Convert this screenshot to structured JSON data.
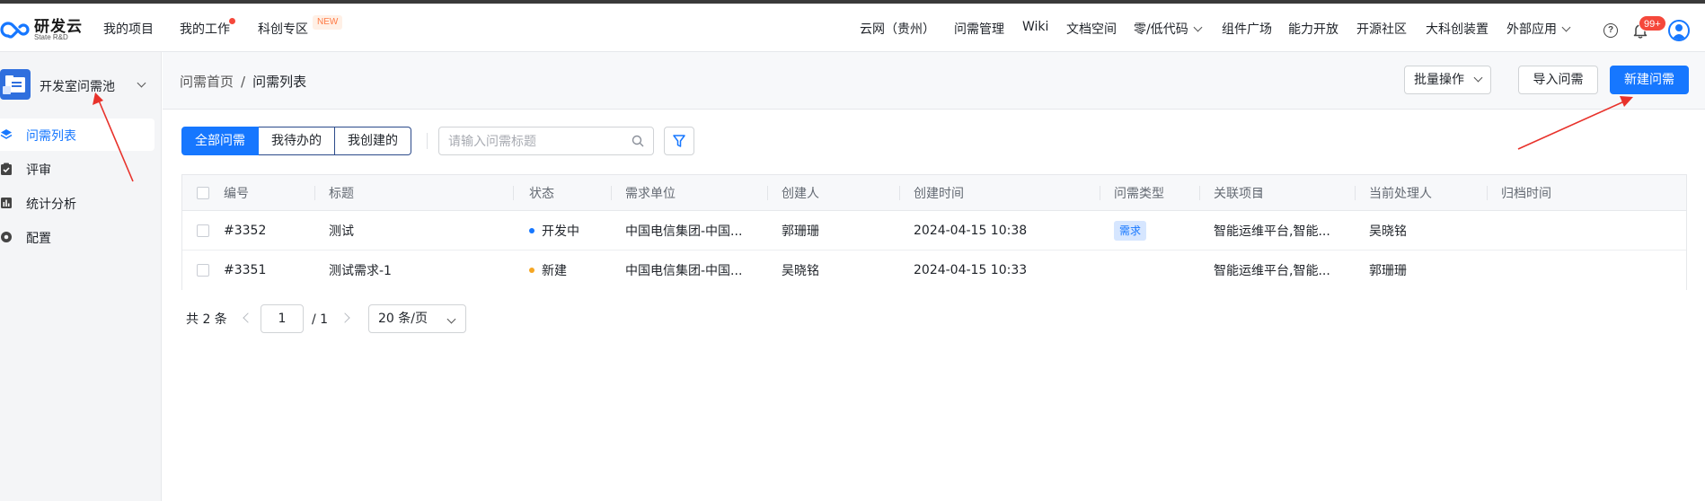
{
  "app": {
    "logo_title": "研发云",
    "logo_subtitle": "State R&D"
  },
  "topnav": {
    "left_items": [
      "我的项目",
      "我的工作",
      "科创专区"
    ],
    "new_tag": "NEW",
    "right_items": [
      "云网（贵州）",
      "问需管理",
      "Wiki",
      "文档空间",
      "零/低代码",
      "组件广场",
      "能力开放",
      "开源社区",
      "大科创装置",
      "外部应用"
    ],
    "notification_badge": "99+"
  },
  "sidebar": {
    "title": "开发室问需池",
    "items": [
      {
        "label": "问需列表",
        "icon": "layers-icon",
        "active": true
      },
      {
        "label": "评审",
        "icon": "clipboard-check-icon",
        "active": false
      },
      {
        "label": "统计分析",
        "icon": "bar-chart-icon",
        "active": false
      },
      {
        "label": "配置",
        "icon": "settings-icon",
        "active": false
      }
    ]
  },
  "breadcrumb": {
    "home": "问需首页",
    "separator": "/",
    "current": "问需列表"
  },
  "actions": {
    "batch": "批量操作",
    "import": "导入问需",
    "create": "新建问需"
  },
  "filters": {
    "tabs": [
      "全部问需",
      "我待办的",
      "我创建的"
    ],
    "active_tab": "全部问需",
    "search_placeholder": "请输入问需标题"
  },
  "table": {
    "columns": [
      "编号",
      "标题",
      "状态",
      "需求单位",
      "创建人",
      "创建时间",
      "问需类型",
      "关联项目",
      "当前处理人",
      "归档时间"
    ],
    "rows": [
      {
        "id": "#3352",
        "title": "测试",
        "status": "开发中",
        "status_color": "#1677ff",
        "unit": "中国电信集团-中国...",
        "creator": "郭珊珊",
        "created": "2024-04-15 10:38",
        "type": "需求",
        "project": "智能运维平台,智能...",
        "handler": "吴晓铭",
        "archived": ""
      },
      {
        "id": "#3351",
        "title": "测试需求-1",
        "status": "新建",
        "status_color": "#f5a623",
        "unit": "中国电信集团-中国...",
        "creator": "吴晓铭",
        "created": "2024-04-15 10:33",
        "type": "",
        "project": "智能运维平台,智能...",
        "handler": "郭珊珊",
        "archived": ""
      }
    ]
  },
  "pagination": {
    "total_text": "共 2 条",
    "current_page": "1",
    "total_pages": "/ 1",
    "page_size": "20 条/页"
  },
  "colors": {
    "primary": "#1677ff",
    "annotation_arrow": "#e8322b"
  }
}
